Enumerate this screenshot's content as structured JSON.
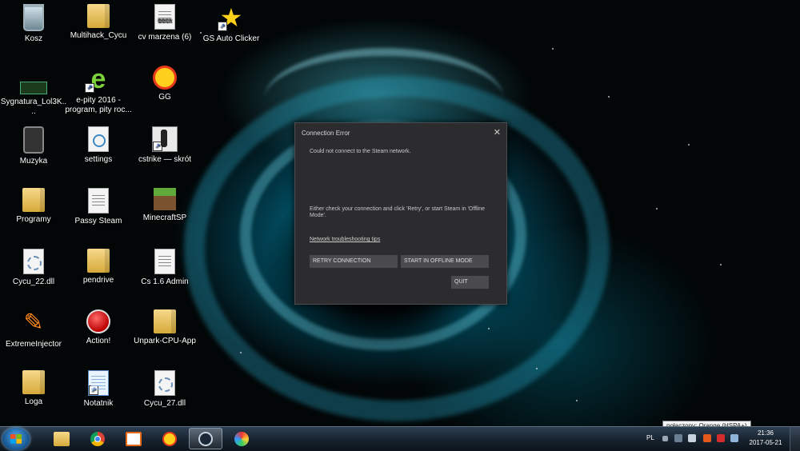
{
  "desktop": {
    "icons": [
      {
        "label": "Kosz"
      },
      {
        "label": "Multihack_Cycu"
      },
      {
        "label": "cv marzena (6)"
      },
      {
        "label": "GS Auto Clicker"
      },
      {
        "label": "Sygnatura_Lol3K...."
      },
      {
        "label": "e-pity 2016 - program, pity roc..."
      },
      {
        "label": "GG"
      },
      {
        "label": "Muzyka"
      },
      {
        "label": "settings"
      },
      {
        "label": "cstrike — skrót"
      },
      {
        "label": "Programy"
      },
      {
        "label": "Passy Steam"
      },
      {
        "label": "MinecraftSP"
      },
      {
        "label": "Cycu_22.dll"
      },
      {
        "label": "pendrive"
      },
      {
        "label": "Cs 1.6 Admin"
      },
      {
        "label": "ExtremeInjector"
      },
      {
        "label": "Action!"
      },
      {
        "label": "Unpark-CPU-App"
      },
      {
        "label": "Loga"
      },
      {
        "label": "Notatnik"
      },
      {
        "label": "Cycu_27.dll"
      }
    ],
    "docx_tag": "DOCX"
  },
  "dialog": {
    "title": "Connection Error",
    "close_glyph": "✕",
    "message": "Could not connect to the Steam network.",
    "help_text": "Either check your connection and click 'Retry', or start Steam in 'Offline Mode'.",
    "link": "Network troubleshooting tips",
    "retry_label": "RETRY CONNECTION",
    "offline_label": "START IN OFFLINE MODE",
    "quit_label": "QUIT"
  },
  "taskbar": {
    "pinned": [
      "folder-icon",
      "chrome-icon",
      "media-icon",
      "gg-icon",
      "steam-icon",
      "paint-icon"
    ],
    "active_item": "steam-icon",
    "language": "PL",
    "clock_time": "21:36",
    "clock_date": "2017-05-21",
    "tooltip": "połączony: Orange (HSPA+)"
  }
}
